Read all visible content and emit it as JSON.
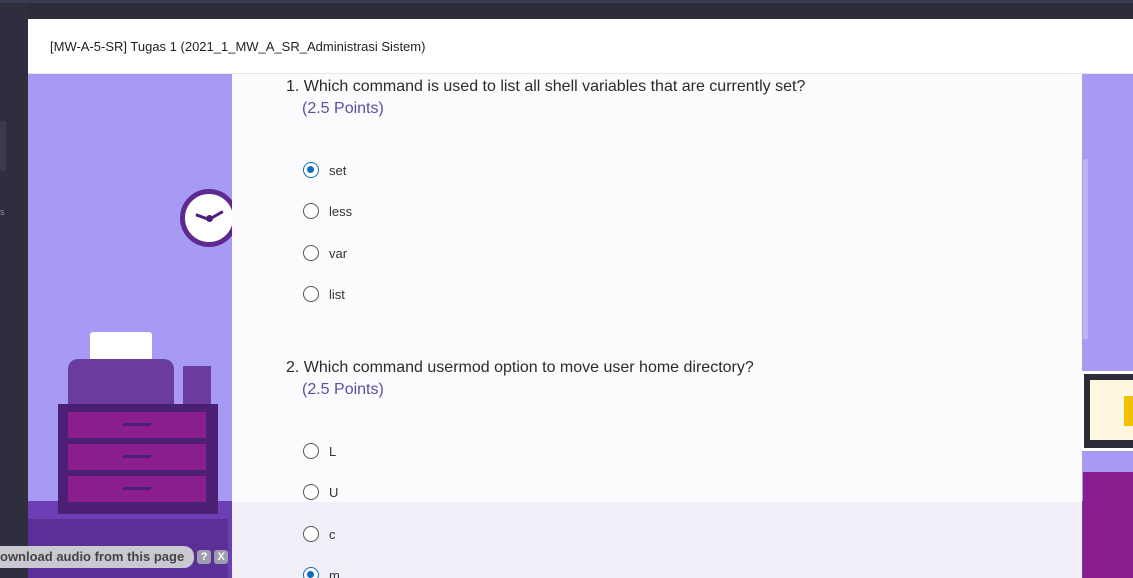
{
  "window": {
    "title": "[MW-A-5-SR] Tugas 1 (2021_1_MW_A_SR_Administrasi Sistem)"
  },
  "left_edge": {
    "glyph": "s"
  },
  "questions": [
    {
      "number": "1.",
      "text": "Which command is used to list all shell variables that are currently set?",
      "points": "(2.5 Points)",
      "options": [
        {
          "label": "set",
          "selected": true
        },
        {
          "label": "less",
          "selected": false
        },
        {
          "label": "var",
          "selected": false
        },
        {
          "label": "list",
          "selected": false
        }
      ]
    },
    {
      "number": "2.",
      "text": "Which command usermod option to move user home directory?",
      "points": "(2.5 Points)",
      "options": [
        {
          "label": "L",
          "selected": false
        },
        {
          "label": "U",
          "selected": false
        },
        {
          "label": "c",
          "selected": false
        },
        {
          "label": "m",
          "selected": true
        }
      ]
    }
  ],
  "download_bar": {
    "text": "ownload audio from this page",
    "help": "?",
    "close": "X"
  },
  "colors": {
    "accent": "#0f6cbd",
    "points": "#5a4fa0",
    "background_theme": "#a79af5"
  }
}
